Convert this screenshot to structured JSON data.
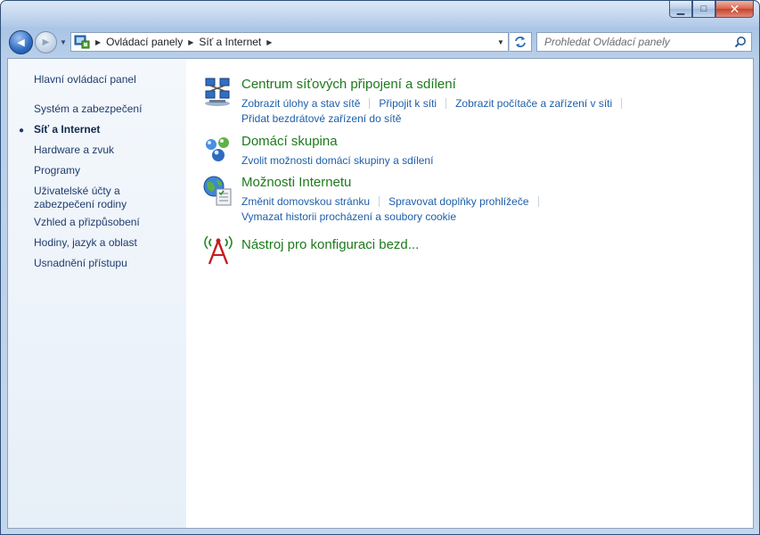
{
  "titlebar": {
    "minimize": "▁",
    "maximize": "□",
    "close": "✕"
  },
  "nav": {
    "back_glyph": "◀",
    "forward_glyph": "▶",
    "recent_glyph": "▼"
  },
  "address": {
    "breadcrumbs": [
      "Ovládací panely",
      "Síť a Internet"
    ],
    "separator": "▶",
    "dropdown_glyph": "▼"
  },
  "search": {
    "placeholder": "Prohledat Ovládací panely"
  },
  "sidebar": {
    "home": "Hlavní ovládací panel",
    "active_bullet": "●",
    "items": [
      {
        "label": "Systém a zabezpečení"
      },
      {
        "label": "Síť a Internet"
      },
      {
        "label": "Hardware a zvuk"
      },
      {
        "label": "Programy"
      },
      {
        "label": "Uživatelské účty a zabezpečení rodiny"
      },
      {
        "label": "Vzhled a přizpůsobení"
      },
      {
        "label": "Hodiny, jazyk a oblast"
      },
      {
        "label": "Usnadnění přístupu"
      }
    ]
  },
  "categories": [
    {
      "title": "Centrum síťových připojení a sdílení",
      "icon": "network-center-icon",
      "links": [
        "Zobrazit úlohy a stav sítě",
        "Připojit k síti",
        "Zobrazit počítače a zařízení v síti",
        "Přidat bezdrátové zařízení do sítě"
      ]
    },
    {
      "title": "Domácí skupina",
      "icon": "homegroup-icon",
      "links": [
        "Zvolit možnosti domácí skupiny a sdílení"
      ]
    },
    {
      "title": "Možnosti Internetu",
      "icon": "internet-options-icon",
      "links": [
        "Změnit domovskou stránku",
        "Spravovat doplňky prohlížeče",
        "Vymazat historii procházení a soubory cookie"
      ]
    },
    {
      "title": "Nástroj pro konfiguraci bezd...",
      "icon": "wireless-config-icon",
      "links": []
    }
  ],
  "colors": {
    "link": "#1e5ea9",
    "category_title": "#1c7a1c",
    "sidebar_text": "#1e3c6e"
  }
}
